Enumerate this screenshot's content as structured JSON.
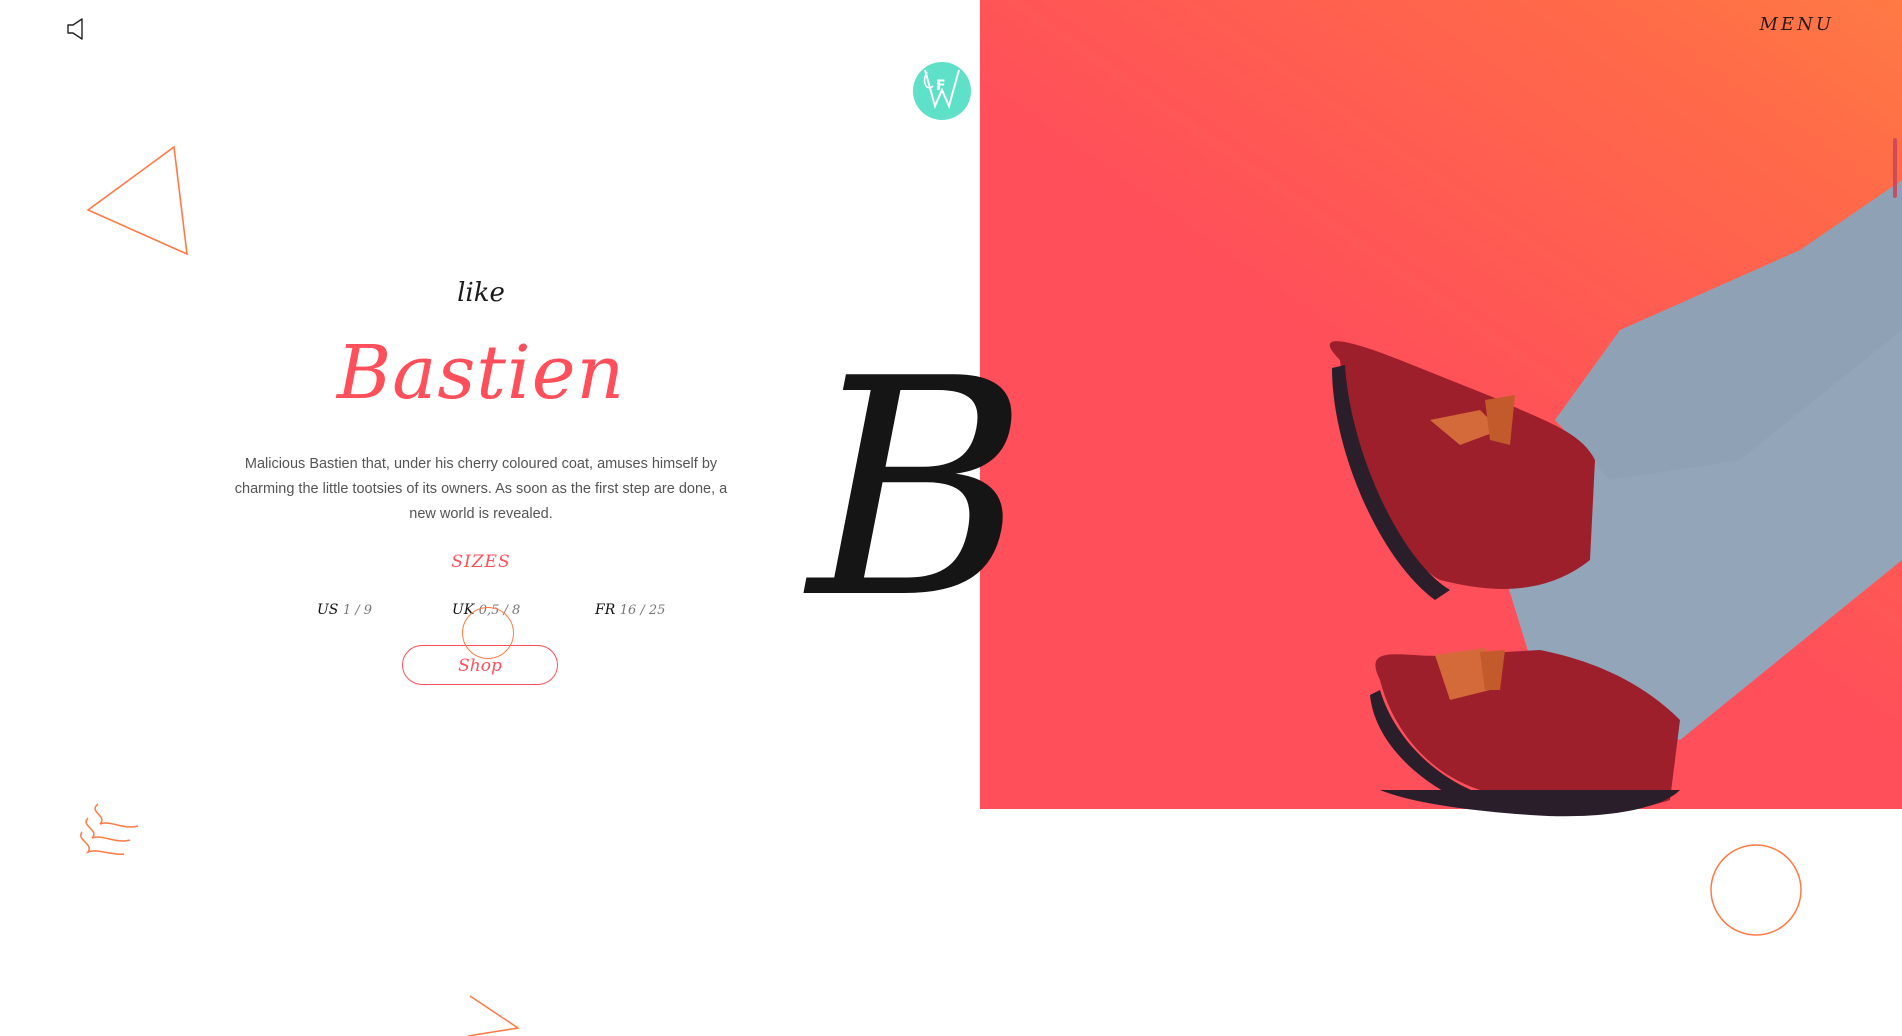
{
  "header": {
    "menu_label": "MENU",
    "sound_icon": "speaker-icon",
    "logo_icon": "brand-logo",
    "logo_letter": "F"
  },
  "product": {
    "intro_word": "like",
    "name": "Bastien",
    "big_letter": "B",
    "description": "Malicious Bastien that, under his cherry coloured coat, amuses himself by charming the little tootsies of its owners. As soon as the first step are done, a new world is revealed.",
    "sizes_title": "SIZES",
    "sizes": [
      {
        "system": "US",
        "value": "1 / 9"
      },
      {
        "system": "UK",
        "value": "0,5 / 8"
      },
      {
        "system": "FR",
        "value": "16 / 25"
      }
    ],
    "shop_label": "Shop"
  },
  "colors": {
    "accent": "#ff4f5a",
    "gradient_end": "#ff7a45",
    "logo": "#5fe0c8",
    "outline_orange": "#ff7a45",
    "shoe": "#9e1f2c",
    "legging": "#93a6b9"
  }
}
